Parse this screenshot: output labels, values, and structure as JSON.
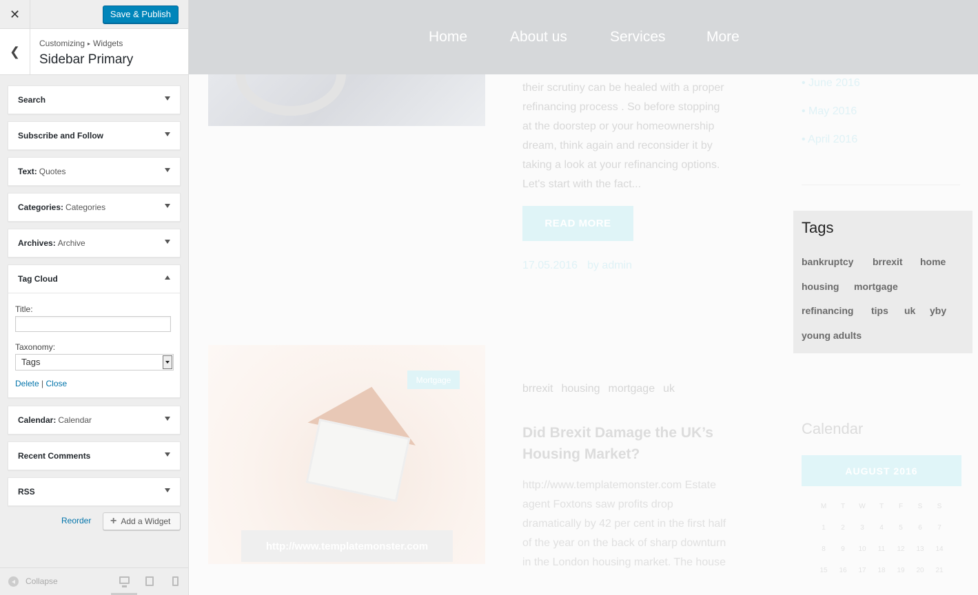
{
  "customizer": {
    "close_icon": "close-icon",
    "publish_label": "Save & Publish",
    "breadcrumb": [
      "Customizing",
      "Widgets"
    ],
    "section_title": "Sidebar Primary",
    "widgets": [
      {
        "title": "Search",
        "subtitle": ""
      },
      {
        "title": "Subscribe and Follow",
        "subtitle": ""
      },
      {
        "title": "Text:",
        "subtitle": "Quotes"
      },
      {
        "title": "Categories:",
        "subtitle": "Categories"
      },
      {
        "title": "Archives:",
        "subtitle": "Archive"
      },
      {
        "title": "Tag Cloud",
        "subtitle": "",
        "expanded": true
      },
      {
        "title": "Calendar:",
        "subtitle": "Calendar"
      },
      {
        "title": "Recent Comments",
        "subtitle": ""
      },
      {
        "title": "RSS",
        "subtitle": ""
      }
    ],
    "tag_cloud_form": {
      "title_label": "Title:",
      "title_value": "",
      "taxonomy_label": "Taxonomy:",
      "taxonomy_value": "Tags",
      "delete_label": "Delete",
      "separator": "|",
      "close_label": "Close"
    },
    "reorder_label": "Reorder",
    "add_widget_label": "Add a Widget",
    "collapse_label": "Collapse"
  },
  "preview": {
    "nav": [
      "Home",
      "About us",
      "Services",
      "More"
    ],
    "post1": {
      "excerpt": [
        "their scrutiny can be healed with a proper",
        "refinancing process . So before stopping",
        "at the doorstep or your homeownership",
        "dream, think again and reconsider it by",
        "taking a look at your refinancing options.",
        "Let's start with the fact..."
      ],
      "read_more": "READ MORE",
      "date": "17.05.2016",
      "author": "by admin"
    },
    "archives": [
      "• June 2016",
      "• May 2016",
      "• April 2016"
    ],
    "tags_widget": {
      "title": "Tags",
      "tags": [
        "bankruptcy",
        "brrexit",
        "home",
        "housing",
        "mortgage",
        "refinancing",
        "tips",
        "uk",
        "yby",
        "young adults"
      ]
    },
    "post2": {
      "category_badge": "Mortgage",
      "image_caption": "http://www.templatemonster.com",
      "tags": [
        "brrexit",
        "housing",
        "mortgage",
        "uk"
      ],
      "title": "Did Brexit Damage the UK’s Housing Market?",
      "excerpt": [
        "http://www.templatemonster.com Estate",
        "agent Foxtons saw profits drop",
        "dramatically by 42 per cent in the first half",
        "of the year on the back of sharp downturn",
        "in the London housing market. The house"
      ]
    },
    "calendar": {
      "title": "Calendar",
      "month": "AUGUST 2016",
      "weekdays": [
        "M",
        "T",
        "W",
        "T",
        "F",
        "S",
        "S"
      ],
      "rows": [
        [
          "1",
          "2",
          "3",
          "4",
          "5",
          "6",
          "7"
        ],
        [
          "8",
          "9",
          "10",
          "11",
          "12",
          "13",
          "14"
        ],
        [
          "15",
          "16",
          "17",
          "18",
          "19",
          "20",
          "21"
        ]
      ]
    }
  }
}
